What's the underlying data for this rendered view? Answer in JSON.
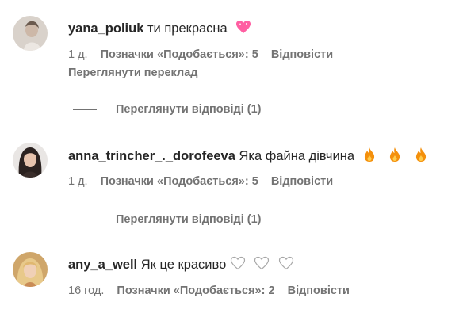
{
  "comments": [
    {
      "username": "yana_poliuk",
      "text": "ти прекрасна",
      "emoji": [
        "sparkling-heart-icon"
      ],
      "time": "1 д.",
      "likes": "Позначки «Подобається»: 5",
      "reply": "Відповісти",
      "translate": "Переглянути переклад",
      "view_replies": "Переглянути відповіді (1)"
    },
    {
      "username": "anna_trincher_._dorofeeva",
      "text": "Яка файна дівчина",
      "emoji": [
        "fire-icon",
        "fire-icon",
        "fire-icon"
      ],
      "time": "1 д.",
      "likes": "Позначки «Подобається»: 5",
      "reply": "Відповісти",
      "view_replies": "Переглянути відповіді (1)"
    },
    {
      "username": "any_a_well",
      "text": "Як це красиво",
      "emoji": [
        "white-heart-icon",
        "white-heart-icon",
        "white-heart-icon"
      ],
      "time": "16 год.",
      "likes": "Позначки «Подобається»: 2",
      "reply": "Відповісти"
    }
  ],
  "colors": {
    "primary_text": "#262626",
    "secondary_text": "#737373",
    "fire": "#f4900c",
    "heart_pink": "#ff5fa2"
  }
}
